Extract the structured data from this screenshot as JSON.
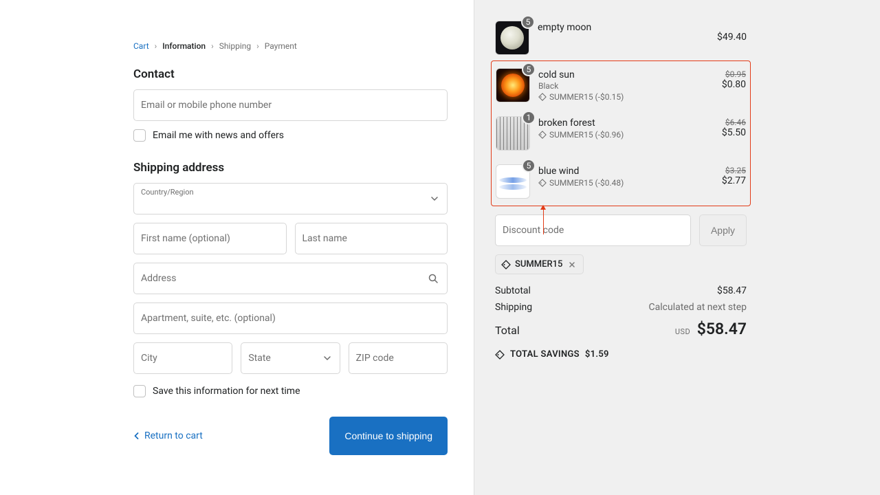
{
  "breadcrumb": {
    "cart": "Cart",
    "information": "Information",
    "shipping": "Shipping",
    "payment": "Payment"
  },
  "contact": {
    "heading": "Contact",
    "email_placeholder": "Email or mobile phone number",
    "newsletter_label": "Email me with news and offers"
  },
  "shipping": {
    "heading": "Shipping address",
    "country_label": "Country/Region",
    "first_name_placeholder": "First name (optional)",
    "last_name_placeholder": "Last name",
    "address_placeholder": "Address",
    "apt_placeholder": "Apartment, suite, etc. (optional)",
    "city_placeholder": "City",
    "state_placeholder": "State",
    "zip_placeholder": "ZIP code",
    "save_label": "Save this information for next time"
  },
  "actions": {
    "return": "Return to cart",
    "continue": "Continue to shipping"
  },
  "cart": {
    "items": [
      {
        "name": "empty moon",
        "qty": "5",
        "price": "$49.40"
      },
      {
        "name": "cold sun",
        "variant": "Black",
        "qty": "5",
        "discount_text": "SUMMER15 (-$0.15)",
        "orig": "$0.95",
        "price": "$0.80"
      },
      {
        "name": "broken forest",
        "qty": "1",
        "discount_text": "SUMMER15 (-$0.96)",
        "orig": "$6.46",
        "price": "$5.50"
      },
      {
        "name": "blue wind",
        "qty": "5",
        "discount_text": "SUMMER15 (-$0.48)",
        "orig": "$3.25",
        "price": "$2.77"
      }
    ],
    "discount_placeholder": "Discount code",
    "apply_label": "Apply",
    "applied_code": "SUMMER15",
    "subtotal_label": "Subtotal",
    "subtotal_value": "$58.47",
    "shipping_label": "Shipping",
    "shipping_value": "Calculated at next step",
    "total_label": "Total",
    "total_currency": "USD",
    "total_value": "$58.47",
    "savings_label": "TOTAL SAVINGS",
    "savings_value": "$1.59"
  }
}
